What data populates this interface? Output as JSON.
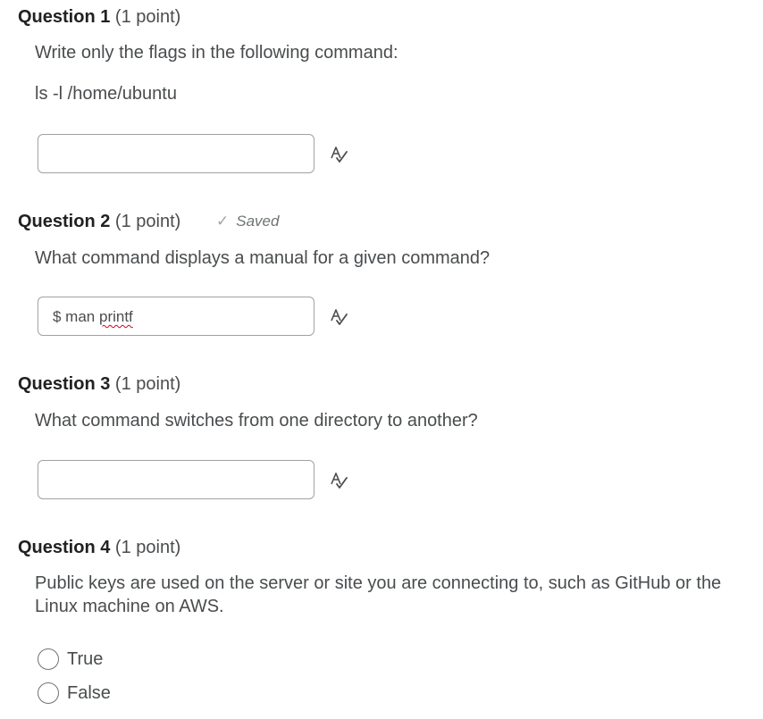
{
  "questions": [
    {
      "number_label": "Question 1",
      "points_label": "(1 point)",
      "prompt": "Write only the flags in the following command:",
      "command": "ls -l /home/ubuntu",
      "answer_value": "",
      "spellcheck_icon": "spellcheck-icon"
    },
    {
      "number_label": "Question 2",
      "points_label": "(1 point)",
      "status": {
        "icon": "check-icon",
        "text": "Saved"
      },
      "prompt": "What command displays a manual for a given command?",
      "answer_prefix": "$ man ",
      "answer_word": "printf",
      "spellcheck_icon": "spellcheck-icon"
    },
    {
      "number_label": "Question 3",
      "points_label": "(1 point)",
      "prompt": "What command switches from one directory to another?",
      "answer_value": "",
      "spellcheck_icon": "spellcheck-icon"
    },
    {
      "number_label": "Question 4",
      "points_label": "(1 point)",
      "prompt": "Public keys are used on the server or site you are connecting to, such as GitHub or the Linux machine on AWS.",
      "options": [
        "True",
        "False"
      ]
    }
  ],
  "colors": {
    "question_title": "#202122",
    "body_text": "#494c4e",
    "input_border": "#9ea2a4",
    "spellcheck_underline": "#d0021b"
  }
}
